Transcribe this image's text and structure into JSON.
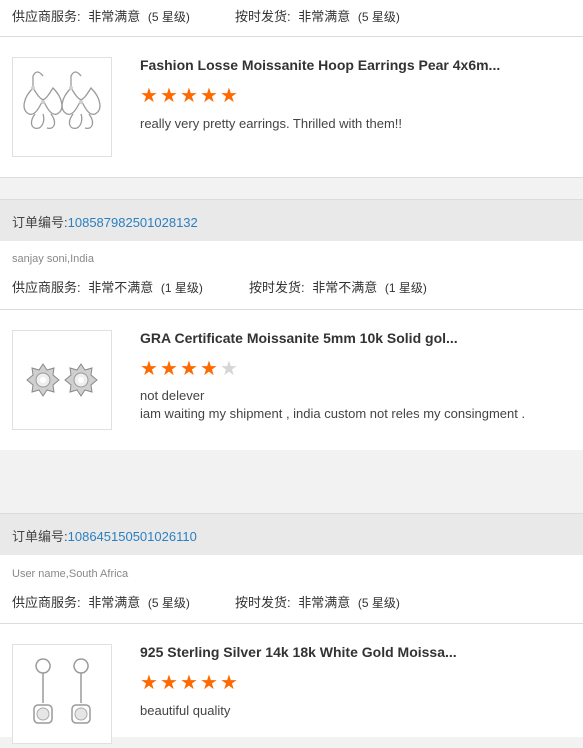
{
  "top_ratings": {
    "supplier_label": "供应商服务:",
    "supplier_value": "非常满意",
    "supplier_level": "(5 星级)",
    "shipping_label": "按时发货:",
    "shipping_value": "非常满意",
    "shipping_level": "(5 星级)"
  },
  "items": [
    {
      "product_title": "Fashion Losse Moissanite Hoop Earrings Pear 4x6m...",
      "stars": 5,
      "comment_lines": [
        "really very pretty earrings. Thrilled with them!!"
      ],
      "thumb_icon": "butterfly-earrings-icon"
    }
  ],
  "orders": [
    {
      "order_label": "订单编号:",
      "order_number": "108587982501028132",
      "buyer": "sanjay soni,India",
      "supplier_label": "供应商服务:",
      "supplier_value": "非常不满意",
      "supplier_level": "(1 星级)",
      "shipping_label": "按时发货:",
      "shipping_value": "非常不满意",
      "shipping_level": "(1 星级)",
      "product_title": "GRA Certificate Moissanite 5mm 10k Solid gol...",
      "stars": 4,
      "comment_lines": [
        "not delever",
        "iam waiting my shipment , india custom not reles my consingment ."
      ],
      "thumb_icon": "stud-earrings-icon"
    },
    {
      "order_label": "订单编号:",
      "order_number": "108645150501026110",
      "buyer": "User name,South Africa",
      "supplier_label": "供应商服务:",
      "supplier_value": "非常满意",
      "supplier_level": "(5 星级)",
      "shipping_label": "按时发货:",
      "shipping_value": "非常满意",
      "shipping_level": "(5 星级)",
      "product_title": "925 Sterling Silver 14k 18k White Gold Moissa...",
      "stars": 5,
      "comment_lines": [
        "beautiful quality"
      ],
      "thumb_icon": "drop-earrings-icon"
    }
  ],
  "colors": {
    "star_on": "#ff6a00",
    "star_off": "#d6d6d6",
    "order_number": "#2b7fc0"
  }
}
